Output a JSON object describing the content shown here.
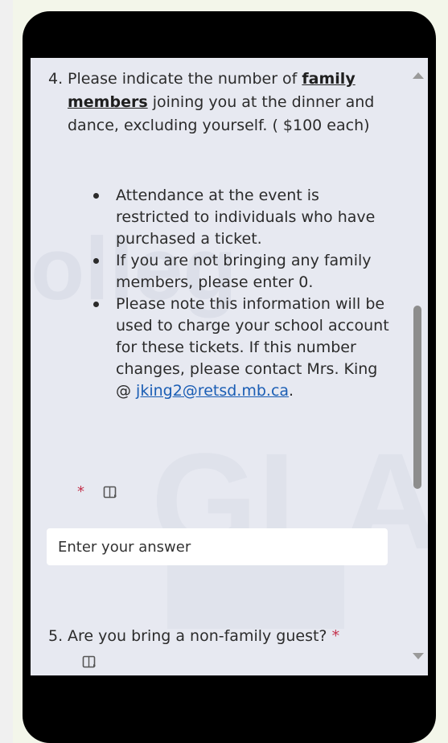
{
  "colors": {
    "page_background": "#f3f6ea",
    "device_frame": "#000000",
    "form_background": "#e7e9f1",
    "required_asterisk": "#c4314b",
    "link": "#1a5db4",
    "scrollbar_thumb": "#8d8d8d"
  },
  "question4": {
    "number": "4.",
    "text_before": "Please indicate the number of ",
    "emphasis": "family members",
    "text_after": " joining you at the dinner and dance, excluding yourself. ( $100 each)",
    "bullets": {
      "first": "Attendance at the event is restricted to individuals who have purchased a ticket.",
      "second": "If you are not bringing any family members, please enter 0.",
      "third_before": "Please note this information will be used to charge your school account for these tickets. If this number changes, please contact Mrs. King @ ",
      "email": "jking2@retsd.mb.ca",
      "third_after": "."
    },
    "required_marker": "*",
    "reader_icon": "immersive-reader-icon",
    "answer_placeholder": "Enter your answer"
  },
  "question5": {
    "number": "5.",
    "text": "Are you bring a non-family guest?",
    "required_marker": "*",
    "reader_icon": "immersive-reader-icon"
  },
  "scrollbar": {
    "up_icon": "scroll-up-arrow-icon",
    "down_icon": "scroll-down-arrow-icon"
  }
}
